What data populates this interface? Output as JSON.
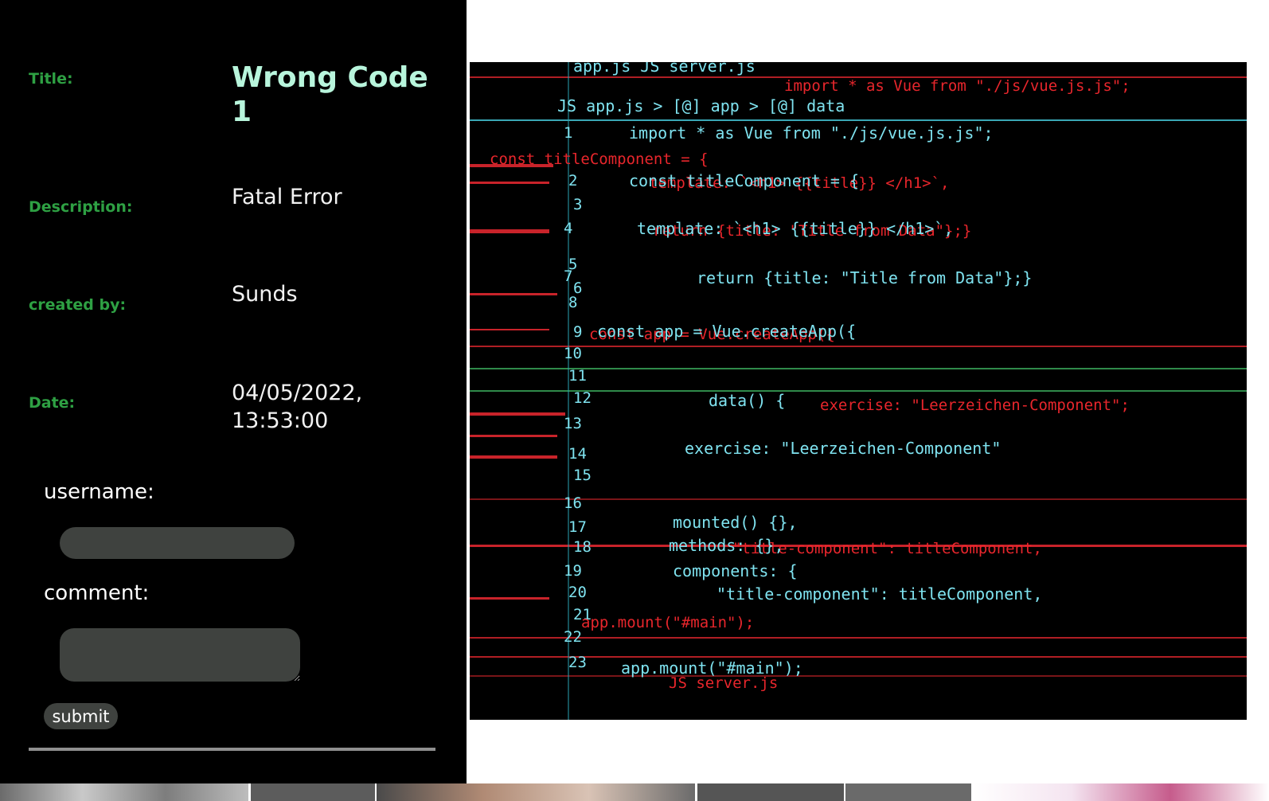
{
  "entry": {
    "title_label": "Title:",
    "title_value": "Wrong Code 1",
    "description_label": "Description:",
    "description_value": "Fatal Error",
    "creator_label": "created by:",
    "creator_value": "Sunds",
    "date_label": "Date:",
    "date_value": "04/05/2022, 13:53:00"
  },
  "form": {
    "username_label": "username:",
    "username_value": "",
    "comment_label": "comment:",
    "comment_value": "",
    "submit_label": "submit"
  },
  "code_image": {
    "line_numbers": [
      "1",
      "2",
      "3",
      "4",
      "5",
      "6",
      "7",
      "8",
      "9",
      "10",
      "11",
      "12",
      "13",
      "14",
      "15",
      "16",
      "17",
      "18",
      "19",
      "20",
      "21",
      "22",
      "23"
    ],
    "cyan_code": [
      "app.js   JS server.js",
      "JS app.js > [@] app > [@] data",
      "import * as Vue from \"./js/vue.js.js\";",
      "const titleComponent = {",
      "template: `<h1> {{title}} </h1>`,",
      "return {title: \"Title from Data\"};}",
      "const app = Vue.createApp({",
      "data() {",
      "exercise: \"Leerzeichen-Component\"",
      "mounted() {},",
      "methods: {},",
      "components: {",
      "\"title-component\": titleComponent,",
      "app.mount(\"#main\");"
    ],
    "red_code": [
      "import * as Vue from \"./js/vue.js.js\";",
      "const titleComponent = {",
      "template: `<h1> {{title}} </h1>`,",
      "return {title: \"Title from Data\"};}",
      "const app = Vue.createApp({",
      "exercise: \"Leerzeichen-Component\";",
      "\"title-component\": titleComponent,",
      "app.mount(\"#main\");",
      "JS server.js"
    ]
  },
  "colors": {
    "panel_background": "#000000",
    "label_green": "#2ea043",
    "title_mint": "#b8f5dc",
    "input_gray": "#3f423f",
    "code_cyan": "#7fe3f0",
    "code_red": "#e8262c"
  }
}
